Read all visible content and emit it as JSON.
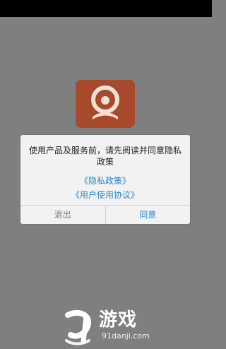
{
  "dialog": {
    "message": "使用产品及服务前，请先阅读并同意隐私政策",
    "privacy_link": "《隐私政策》",
    "agreement_link": "《用户使用协议》",
    "exit_label": "退出",
    "agree_label": "同意"
  },
  "watermark": {
    "title": "游戏",
    "url": "91danji.com"
  },
  "colors": {
    "overlay": "#7f7f7f",
    "icon": "#a74a2b",
    "link": "#2f86c9"
  },
  "icons": {
    "app_icon": "webcam-icon"
  }
}
